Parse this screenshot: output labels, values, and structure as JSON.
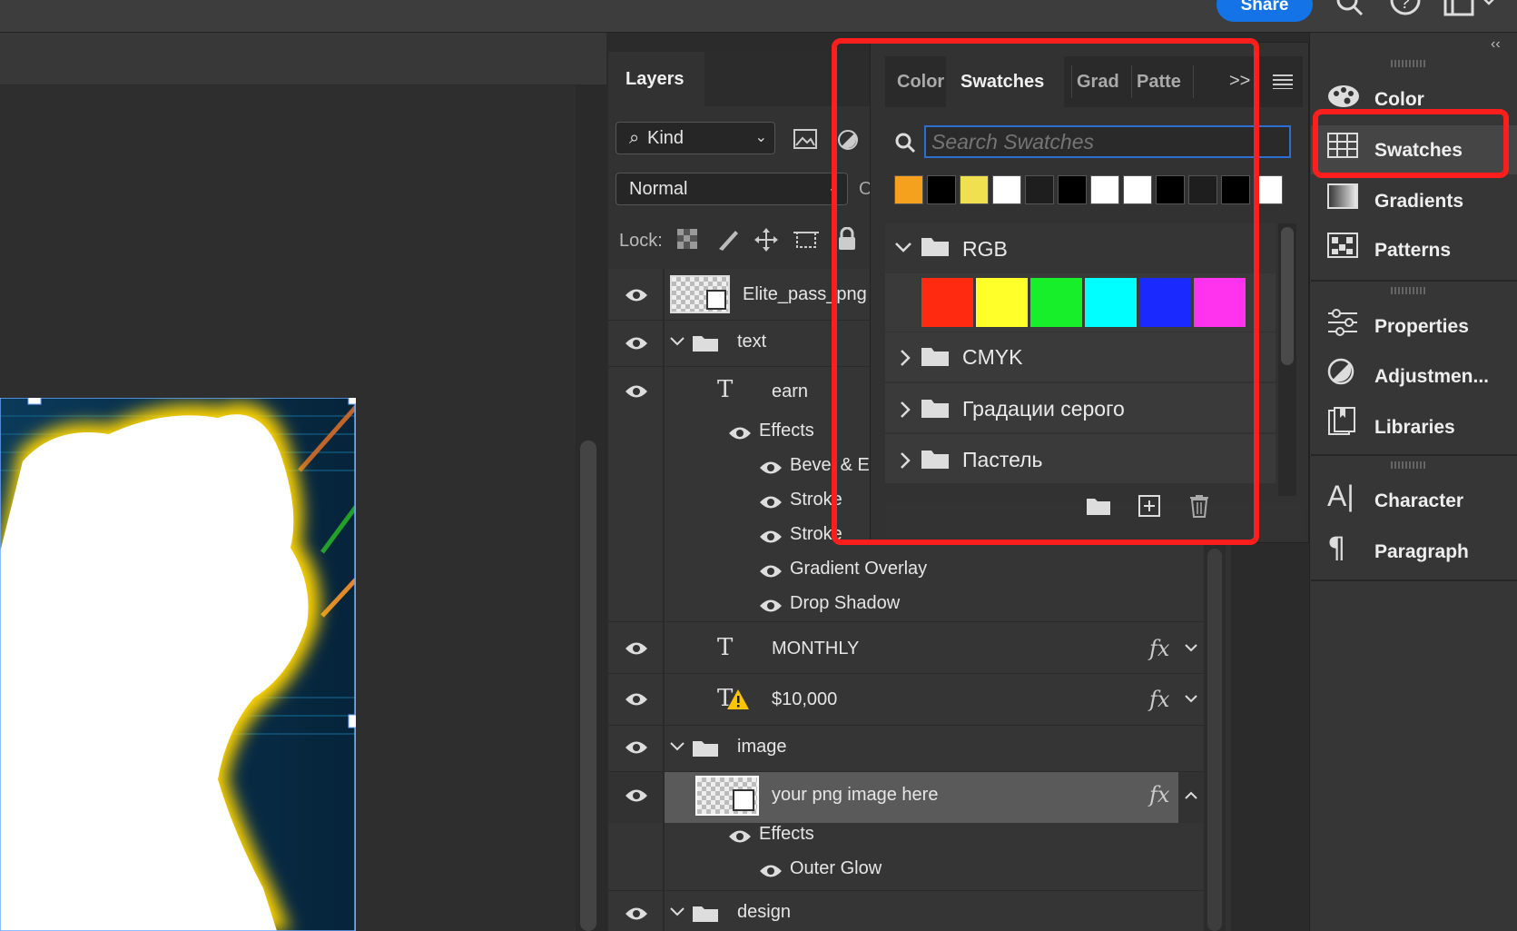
{
  "topbar": {
    "share_label": "Share"
  },
  "layers": {
    "tab_label": "Layers",
    "kind_filter": "Kind",
    "blend_mode": "Normal",
    "opacity_label_partial": "Op",
    "lock_label": "Lock:",
    "rows": [
      {
        "name": "Elite_pass_png",
        "type": "smart-object"
      },
      {
        "name": "text",
        "type": "group",
        "expanded": true
      },
      {
        "name": "earn",
        "type": "text"
      },
      {
        "name": "Effects"
      },
      {
        "name": "Bevel & Emboss"
      },
      {
        "name": "Stroke"
      },
      {
        "name": "Stroke"
      },
      {
        "name": "Gradient Overlay"
      },
      {
        "name": "Drop Shadow"
      },
      {
        "name": "MONTHLY",
        "type": "text",
        "fx": "fx"
      },
      {
        "name": "$10,000",
        "type": "text-warning",
        "fx": "fx"
      },
      {
        "name": "image",
        "type": "group",
        "expanded": true
      },
      {
        "name": "your png image here",
        "type": "smart-object",
        "fx": "fx",
        "selected": true
      },
      {
        "name": "Effects"
      },
      {
        "name": "Outer Glow"
      },
      {
        "name": "design",
        "type": "group",
        "expanded": true
      }
    ]
  },
  "swatches_panel": {
    "tabs": [
      "Color",
      "Swatches",
      "Grad",
      "Patte"
    ],
    "active_tab": "Swatches",
    "overflow_label": ">>",
    "search_placeholder": "Search Swatches",
    "recent_swatches": [
      "#f5a11d",
      "#000000",
      "#f0e050",
      "#ffffff",
      "#1e1e1e",
      "#000000",
      "#ffffff",
      "#ffffff",
      "#000000",
      "#1e1e1e",
      "#000000",
      "#ffffff"
    ],
    "groups": [
      {
        "name": "RGB",
        "expanded": true,
        "colors": [
          "#ff2a10",
          "#ffff2a",
          "#16ef2a",
          "#00ffff",
          "#1a2aff",
          "#ff33ee"
        ]
      },
      {
        "name": "CMYK",
        "expanded": false
      },
      {
        "name": "Градации серого",
        "expanded": false
      },
      {
        "name": "Пастель",
        "expanded": false
      }
    ]
  },
  "dock": {
    "items": [
      {
        "label": "Color",
        "icon": "palette-icon"
      },
      {
        "label": "Swatches",
        "icon": "swatches-grid-icon",
        "highlighted": true
      },
      {
        "label": "Gradients",
        "icon": "gradient-icon"
      },
      {
        "label": "Patterns",
        "icon": "patterns-icon"
      },
      {
        "label": "Properties",
        "icon": "sliders-icon"
      },
      {
        "label": "Adjustmen...",
        "icon": "adjustment-icon"
      },
      {
        "label": "Libraries",
        "icon": "libraries-icon"
      },
      {
        "label": "Character",
        "icon": "character-icon"
      },
      {
        "label": "Paragraph",
        "icon": "pilcrow-icon"
      }
    ]
  },
  "colors": {
    "accent_blue": "#1473e6",
    "highlight_red": "#ff1e1e",
    "glow_yellow": "#ffd400"
  }
}
